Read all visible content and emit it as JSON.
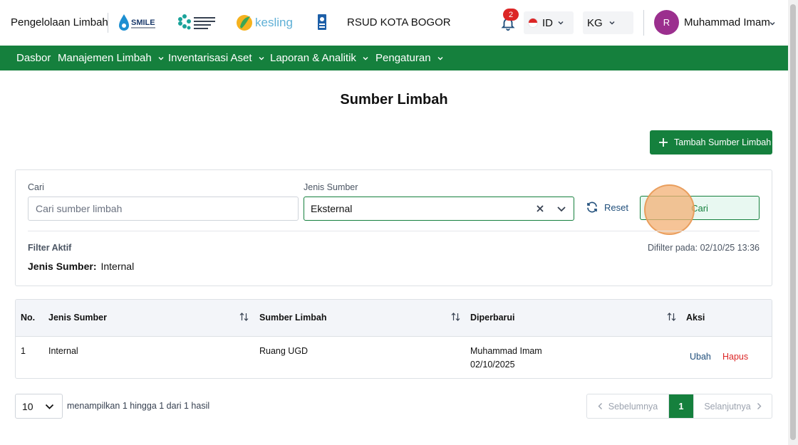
{
  "header": {
    "app_title": "Pengelolaan Limbah",
    "logos": {
      "smile": "SMILE",
      "kemenkes": "KEMENTERIAN KESEHATAN REPUBLIK INDONESIA",
      "kesling": "kesling"
    },
    "hospital": "RSUD KOTA BOGOR",
    "notification_count": "2",
    "language": "ID",
    "unit": "KG",
    "avatar_initial": "R",
    "user_name": "Muhammad Imam"
  },
  "nav": {
    "items": [
      {
        "label": "Dasbor",
        "has_menu": false
      },
      {
        "label": "Manajemen Limbah",
        "has_menu": true
      },
      {
        "label": "Inventarisasi Aset",
        "has_menu": true
      },
      {
        "label": "Laporan & Analitik",
        "has_menu": true
      },
      {
        "label": "Pengaturan",
        "has_menu": true
      }
    ]
  },
  "page": {
    "title": "Sumber Limbah",
    "add_button": "Tambah Sumber Limbah"
  },
  "filter": {
    "search_label": "Cari",
    "search_placeholder": "Cari sumber limbah",
    "search_value": "",
    "type_label": "Jenis Sumber",
    "type_value": "Eksternal",
    "reset_label": "Reset",
    "search_button": "Cari",
    "active_label": "Filter Aktif",
    "filtered_at": "Difilter pada: 02/10/25 13:36",
    "active_chip_key": "Jenis Sumber:",
    "active_chip_value": "Internal"
  },
  "table": {
    "headers": [
      "No.",
      "Jenis Sumber",
      "Sumber Limbah",
      "Diperbarui",
      "Aksi"
    ],
    "rows": [
      {
        "no": "1",
        "type": "Internal",
        "source": "Ruang UGD",
        "updated_by": "Muhammad Imam",
        "updated_date": "02/10/2025",
        "edit": "Ubah",
        "delete": "Hapus"
      }
    ]
  },
  "footer": {
    "per_page": "10",
    "showing": "menampilkan 1 hingga 1 dari 1 hasil",
    "prev": "Sebelumnya",
    "current_page": "1",
    "next": "Selanjutnya"
  },
  "colors": {
    "primary_green": "#15803d",
    "danger": "#dc2626",
    "link": "#1e4d7a",
    "avatar": "#9b2f8e"
  }
}
